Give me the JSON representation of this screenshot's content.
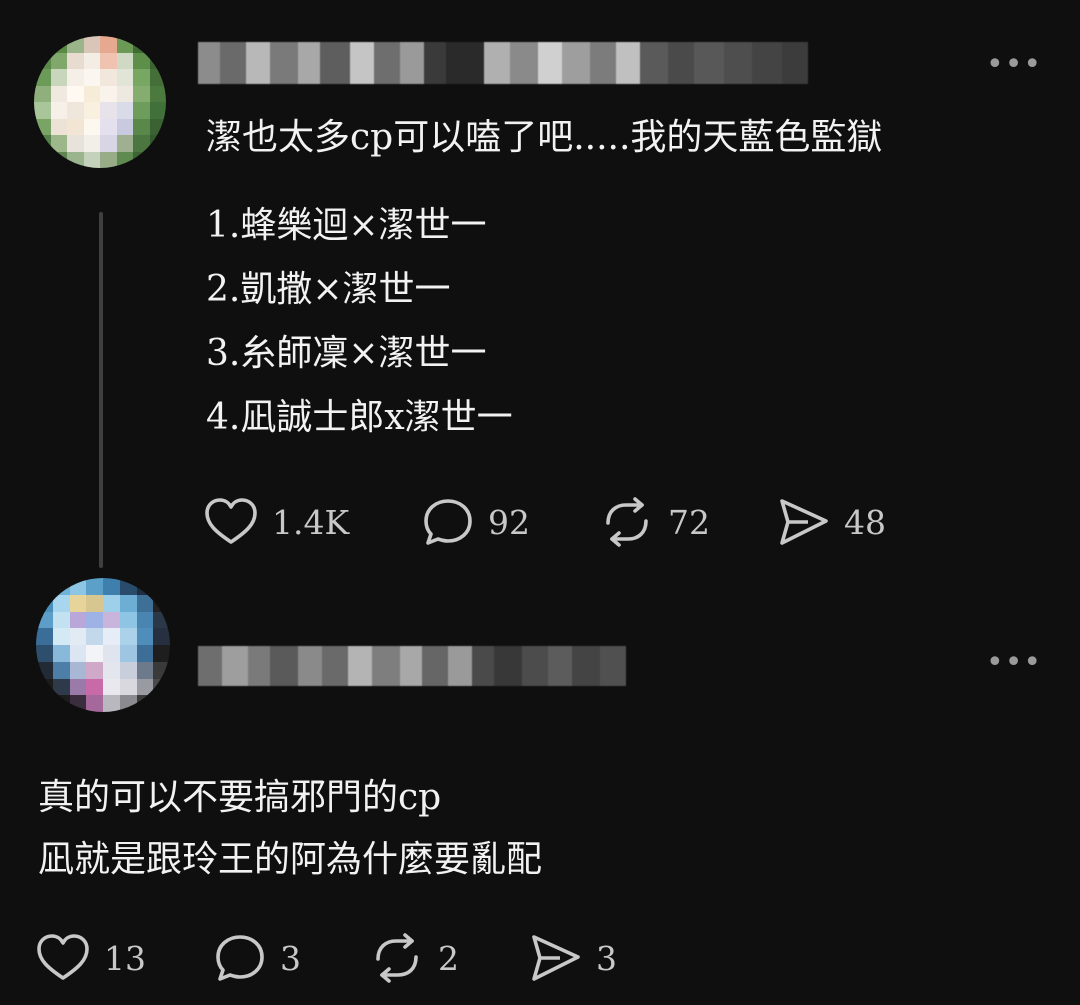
{
  "post1": {
    "title": "潔也太多cp可以嗑了吧.....我的天藍色監獄",
    "lines": [
      "1.蜂樂迴×潔世一",
      "2.凱撒×潔世一",
      "3.糸師凜×潔世一",
      "4.凪誠士郎x潔世一"
    ],
    "likes": "1.4K",
    "comments": "92",
    "reposts": "72",
    "shares": "48"
  },
  "post2": {
    "lines": [
      "真的可以不要搞邪門的cp",
      "凪就是跟玲王的阿為什麼要亂配"
    ],
    "likes": "13",
    "comments": "3",
    "reposts": "2",
    "shares": "3"
  },
  "icons": {
    "more": "more-icon",
    "like": "heart-icon",
    "comment": "comment-icon",
    "repost": "repost-icon",
    "share": "send-icon"
  },
  "colors": {
    "background": "#0f0f0f",
    "text": "#f2f2f2",
    "icon": "#c8c8c8",
    "thread_line": "#3f3f3f"
  }
}
